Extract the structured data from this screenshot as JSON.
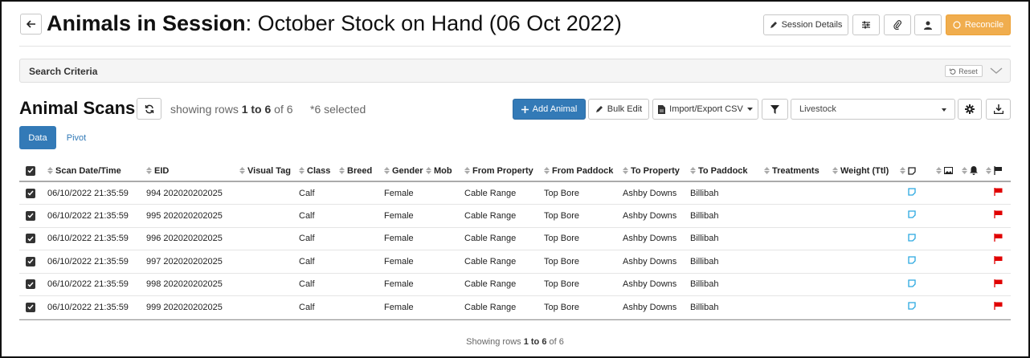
{
  "header": {
    "title_strong": "Animals in Session",
    "title_rest": ": October Stock on Hand (06 Oct 2022)",
    "session_details_label": "Session Details",
    "reconcile_label": "Reconcile"
  },
  "search": {
    "label": "Search Criteria",
    "reset_label": "Reset"
  },
  "scans": {
    "title": "Animal Scans",
    "rows_prefix": "showing rows ",
    "rows_range": "1 to 6",
    "rows_of": " of 6",
    "selected": "*6 selected",
    "add_animal_label": "Add Animal",
    "bulk_edit_label": "Bulk Edit",
    "import_export_label": "Import/Export CSV",
    "livestock_value": "Livestock"
  },
  "tabs": [
    {
      "label": "Data"
    },
    {
      "label": "Pivot"
    }
  ],
  "table": {
    "columns": [
      "Scan Date/Time",
      "EID",
      "Visual Tag",
      "Class",
      "Breed",
      "Gender",
      "Mob",
      "From Property",
      "From Paddock",
      "To Property",
      "To Paddock",
      "Treatments",
      "Weight (Ttl)"
    ],
    "rows": [
      {
        "scan": "06/10/2022 21:35:59",
        "eid": "994 202020202025",
        "visual_tag": "",
        "class": "Calf",
        "breed": "",
        "gender": "Female",
        "mob": "",
        "from_property": "Cable Range",
        "from_paddock": "Top Bore",
        "to_property": "Ashby Downs",
        "to_paddock": "Billibah",
        "treatments": "",
        "weight": ""
      },
      {
        "scan": "06/10/2022 21:35:59",
        "eid": "995 202020202025",
        "visual_tag": "",
        "class": "Calf",
        "breed": "",
        "gender": "Female",
        "mob": "",
        "from_property": "Cable Range",
        "from_paddock": "Top Bore",
        "to_property": "Ashby Downs",
        "to_paddock": "Billibah",
        "treatments": "",
        "weight": ""
      },
      {
        "scan": "06/10/2022 21:35:59",
        "eid": "996 202020202025",
        "visual_tag": "",
        "class": "Calf",
        "breed": "",
        "gender": "Female",
        "mob": "",
        "from_property": "Cable Range",
        "from_paddock": "Top Bore",
        "to_property": "Ashby Downs",
        "to_paddock": "Billibah",
        "treatments": "",
        "weight": ""
      },
      {
        "scan": "06/10/2022 21:35:59",
        "eid": "997 202020202025",
        "visual_tag": "",
        "class": "Calf",
        "breed": "",
        "gender": "Female",
        "mob": "",
        "from_property": "Cable Range",
        "from_paddock": "Top Bore",
        "to_property": "Ashby Downs",
        "to_paddock": "Billibah",
        "treatments": "",
        "weight": ""
      },
      {
        "scan": "06/10/2022 21:35:59",
        "eid": "998 202020202025",
        "visual_tag": "",
        "class": "Calf",
        "breed": "",
        "gender": "Female",
        "mob": "",
        "from_property": "Cable Range",
        "from_paddock": "Top Bore",
        "to_property": "Ashby Downs",
        "to_paddock": "Billibah",
        "treatments": "",
        "weight": ""
      },
      {
        "scan": "06/10/2022 21:35:59",
        "eid": "999 202020202025",
        "visual_tag": "",
        "class": "Calf",
        "breed": "",
        "gender": "Female",
        "mob": "",
        "from_property": "Cable Range",
        "from_paddock": "Top Bore",
        "to_property": "Ashby Downs",
        "to_paddock": "Billibah",
        "treatments": "",
        "weight": ""
      }
    ]
  },
  "footer": {
    "prefix": "Showing rows ",
    "range": "1 to 6",
    "suffix": " of 6"
  },
  "colors": {
    "primary": "#337ab7",
    "reconcile": "#f0ad4e",
    "note_icon": "#29a8e0",
    "flag_icon": "#e00000"
  },
  "icons": [
    "back-arrow-icon",
    "pencil-icon",
    "sliders-icon",
    "paperclip-icon",
    "user-icon",
    "circle-icon",
    "undo-icon",
    "chevron-down-icon",
    "refresh-icon",
    "plus-icon",
    "file-icon",
    "filter-icon",
    "gear-icon",
    "download-icon",
    "note-icon",
    "image-icon",
    "bell-icon",
    "flag-icon",
    "checkbox-icon"
  ]
}
